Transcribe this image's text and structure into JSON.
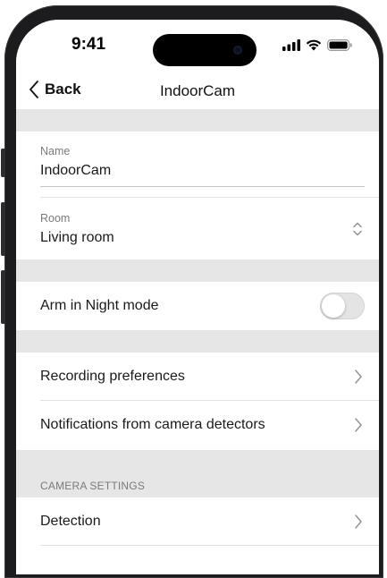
{
  "status_bar": {
    "time": "9:41",
    "icons": [
      "signal-icon",
      "wifi-icon",
      "battery-icon"
    ]
  },
  "nav": {
    "back_label": "Back",
    "title": "IndoorCam"
  },
  "fields": {
    "name": {
      "label": "Name",
      "value": "IndoorCam"
    },
    "room": {
      "label": "Room",
      "value": "Living room"
    }
  },
  "night_mode": {
    "label": "Arm in Night mode",
    "enabled": false
  },
  "rows": {
    "recording": "Recording preferences",
    "notifications": "Notifications from camera detectors"
  },
  "camera_settings": {
    "header": "CAMERA SETTINGS",
    "detection": "Detection"
  },
  "colors": {
    "background": "#ececec",
    "cell": "#ffffff",
    "toggle_off": "#e4e4e4",
    "text": "#1a1a1a",
    "secondary_text": "#7a7a7a"
  }
}
